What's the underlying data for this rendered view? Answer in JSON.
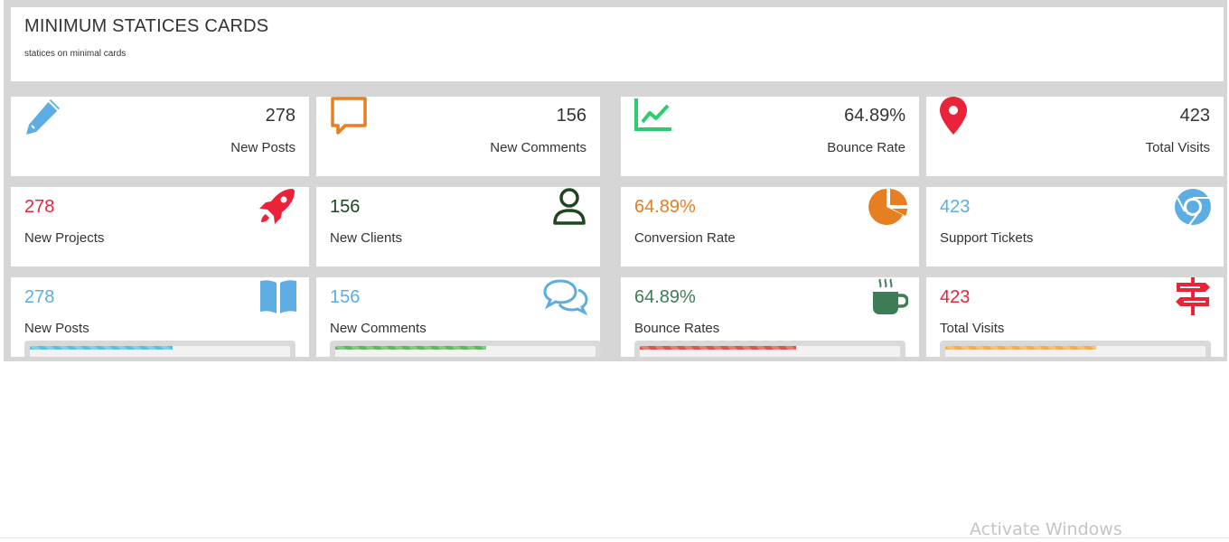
{
  "header": {
    "title": "MINIMUM STATICES CARDS",
    "subtitle": "statices on minimal cards"
  },
  "row1": [
    {
      "value": "278",
      "label": "New Posts",
      "icon": "pencil-icon",
      "color": "#5dade2"
    },
    {
      "value": "156",
      "label": "New Comments",
      "icon": "comment-icon",
      "color": "#e67e22"
    },
    {
      "value": "64.89%",
      "label": "Bounce Rate",
      "icon": "line-chart-icon",
      "color": "#2ecc71"
    },
    {
      "value": "423",
      "label": "Total Visits",
      "icon": "map-marker-icon",
      "color": "#e8233a"
    }
  ],
  "row2": [
    {
      "value": "278",
      "label": "New Projects",
      "icon": "rocket-icon",
      "color": "#e8233a"
    },
    {
      "value": "156",
      "label": "New Clients",
      "icon": "user-icon",
      "color": "#1e4620"
    },
    {
      "value": "64.89%",
      "label": "Conversion Rate",
      "icon": "pie-chart-icon",
      "color": "#e67e22"
    },
    {
      "value": "423",
      "label": "Support Tickets",
      "icon": "chrome-icon",
      "color": "#5dade2"
    }
  ],
  "row3": [
    {
      "value": "278",
      "label": "New Posts",
      "icon": "book-icon",
      "color": "#5dade2",
      "progress": 0.55
    },
    {
      "value": "156",
      "label": "New Comments",
      "icon": "comments-icon",
      "color": "#5dade2",
      "bar_color": "#5cb85c",
      "progress": 0.58
    },
    {
      "value": "64.89%",
      "label": "Bounce Rates",
      "icon": "coffee-icon",
      "color": "#3d7d55",
      "bar_color": "#d9534f",
      "progress": 0.6
    },
    {
      "value": "423",
      "label": "Total Visits",
      "icon": "signpost-icon",
      "color": "#e8233a",
      "bar_color": "#f0ad4e",
      "progress": 0.58
    }
  ],
  "watermark": "Activate Windows"
}
